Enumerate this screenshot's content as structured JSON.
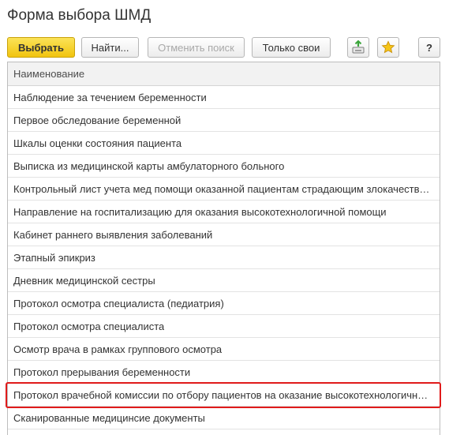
{
  "window": {
    "title": "Форма выбора ШМД"
  },
  "toolbar": {
    "select_label": "Выбрать",
    "find_label": "Найти...",
    "cancel_search_label": "Отменить поиск",
    "only_mine_label": "Только свои",
    "help_label": "?",
    "icons": {
      "export": "save-to-disk-icon",
      "favorite": "star-icon"
    }
  },
  "table": {
    "column_header": "Наименование",
    "rows": [
      "Наблюдение за течением беременности",
      "Первое обследование беременной",
      "Шкалы оценки состояния пациента",
      "Выписка из медицинской карты амбулаторного больного",
      "Контрольный лист учета мед помощи оказанной пациентам страдающим злокачественными новообразованиями",
      "Направление на госпитализацию для оказания высокотехнологичной помощи",
      "Кабинет раннего выявления заболеваний",
      "Этапный эпикриз",
      "Дневник медицинской сестры",
      "Протокол осмотра специалиста (педиатрия)",
      "Протокол осмотра специалиста",
      "Осмотр врача в рамках группового осмотра",
      "Протокол прерывания беременности",
      "Протокол врачебной комиссии по отбору пациентов на оказание высокотехнологичной медицинской помощи",
      "Сканированные медицинсие документы"
    ],
    "selected_row_index": 13
  },
  "colors": {
    "primary_button": "#f5d000",
    "highlight_border": "#e01b1b",
    "favorite_star": "#f2b600",
    "export_icon": "#4caf50"
  }
}
